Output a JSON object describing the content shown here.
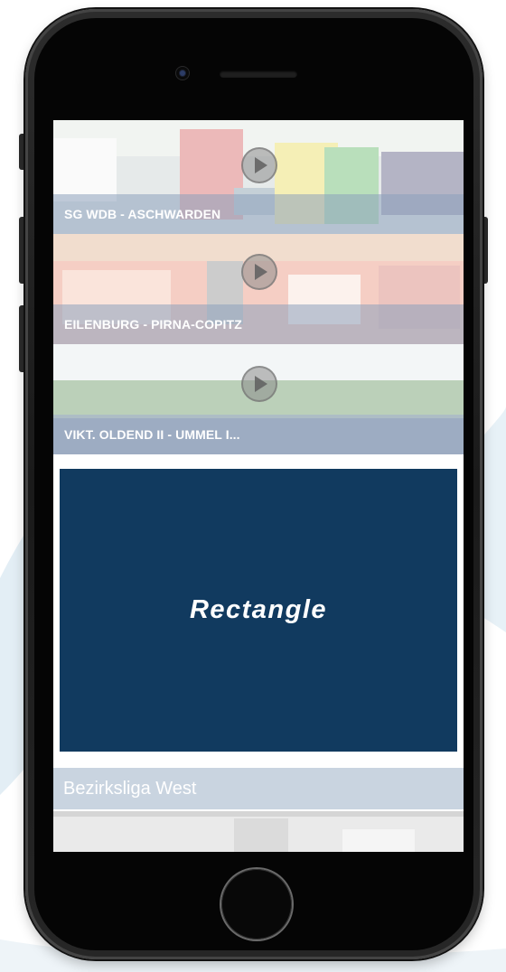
{
  "videos": [
    {
      "title": "SG WDB - ASCHWARDEN",
      "icon": "play-icon"
    },
    {
      "title": "EILENBURG - PIRNA-COPITZ",
      "icon": "play-icon"
    },
    {
      "title": "VIKT. OLDEND II - UMMEL I...",
      "icon": "play-icon"
    }
  ],
  "ad": {
    "label": "Rectangle"
  },
  "section": {
    "title": "Bezirksliga West"
  },
  "colors": {
    "ad_background": "#113a5f",
    "caption_overlay": "#8ca0bc",
    "section_header": "#c9d4e0"
  }
}
